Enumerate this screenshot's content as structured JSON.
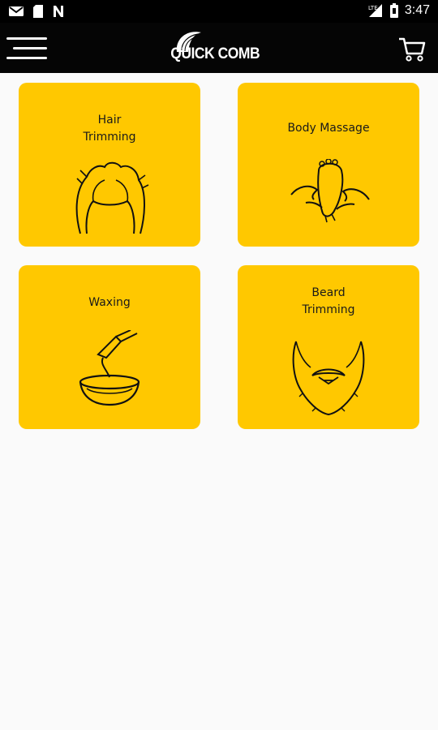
{
  "status_bar": {
    "time": "3:47",
    "left_icons": [
      "gmail-icon",
      "sd-card-icon",
      "n-notification-icon"
    ],
    "right_icons": [
      "lte-signal-icon",
      "battery-icon"
    ]
  },
  "app_bar": {
    "logo_text": "QUICK COMB",
    "menu_icon": "hamburger-menu-icon",
    "cart_icon": "shopping-cart-icon"
  },
  "services": [
    {
      "title": "Hair\nTrimming",
      "icon": "hair-icon"
    },
    {
      "title": "Body Massage",
      "icon": "foot-massage-icon"
    },
    {
      "title": "Waxing",
      "icon": "wax-bowl-icon"
    },
    {
      "title": "Beard\nTrimming",
      "icon": "beard-icon"
    }
  ],
  "colors": {
    "card_background": "#ffc800",
    "app_bar": "#050505",
    "page_background": "#fafafa"
  }
}
